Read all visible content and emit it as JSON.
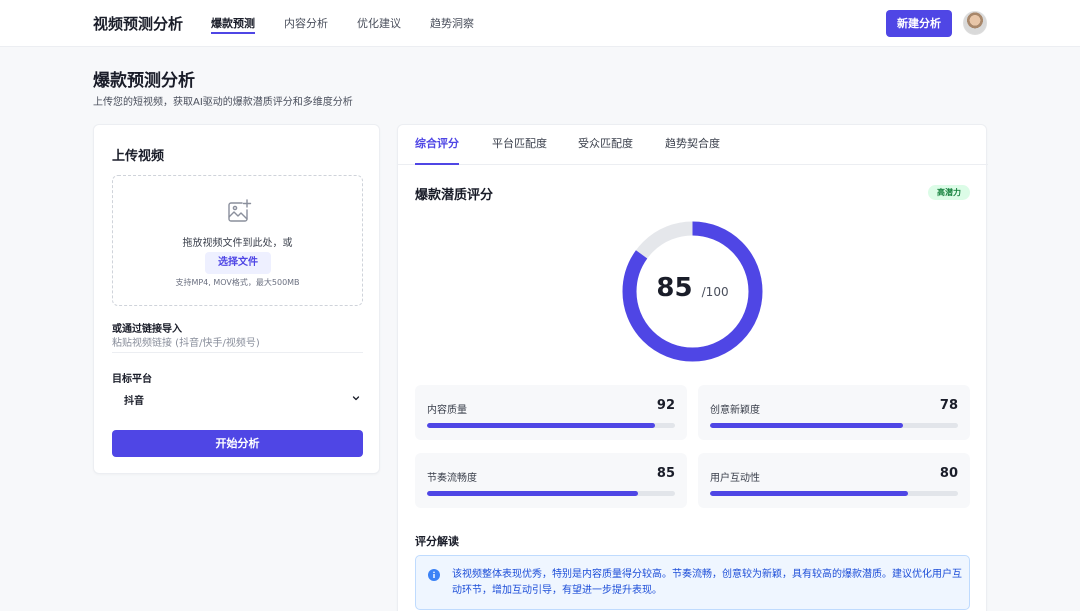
{
  "header": {
    "brand": "视频预测分析",
    "nav": [
      "爆款预测",
      "内容分析",
      "优化建议",
      "趋势洞察"
    ],
    "new_button": "新建分析"
  },
  "page": {
    "title": "爆款预测分析",
    "subtitle": "上传您的短视频，获取AI驱动的爆款潜质评分和多维度分析"
  },
  "upload": {
    "title": "上传视频",
    "drop_text": "拖放视频文件到此处，或",
    "choose_button": "选择文件",
    "hint": "支持MP4, MOV格式，最大500MB",
    "link_label": "或通过链接导入",
    "link_placeholder": "粘贴视频链接 (抖音/快手/视频号)",
    "platform_label": "目标平台",
    "platform_value": "抖音",
    "start_button": "开始分析"
  },
  "results": {
    "tabs": [
      "综合评分",
      "平台匹配度",
      "受众匹配度",
      "趋势契合度"
    ],
    "score_title": "爆款潜质评分",
    "badge": "高潜力",
    "score": 85,
    "score_max": "/100",
    "metrics": [
      {
        "label": "内容质量",
        "value": 92
      },
      {
        "label": "创意新颖度",
        "value": 78
      },
      {
        "label": "节奏流畅度",
        "value": 85
      },
      {
        "label": "用户互动性",
        "value": 80
      }
    ],
    "interp_title": "评分解读",
    "interp_text": "该视频整体表现优秀，特别是内容质量得分较高。节奏流畅，创意较为新颖，具有较高的爆款潜质。建议优化用户互动环节，增加互动引导，有望进一步提升表现。"
  },
  "colors": {
    "accent": "#4f46e5",
    "badge_bg": "#dcfce7",
    "badge_text": "#15803d",
    "info_bg": "#eff6ff",
    "info_text": "#1d4ed8"
  },
  "icons": {
    "upload": "image-plus-icon",
    "select": "chevron-down-icon",
    "info": "info-icon"
  }
}
